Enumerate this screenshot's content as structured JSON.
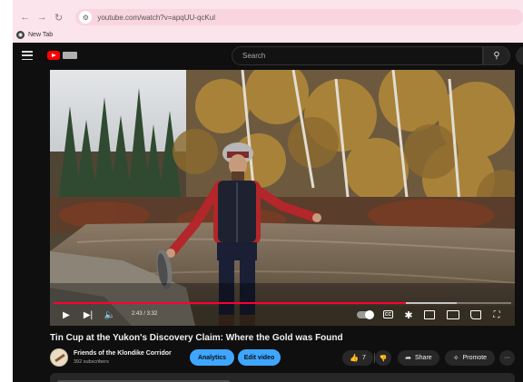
{
  "browser": {
    "back_icon": "arrow-left-icon",
    "forward_icon": "arrow-right-icon",
    "reload_icon": "reload-icon",
    "url": "youtube.com/watch?v=apqUU-qcKul",
    "bookmark_label": "New Tab"
  },
  "youtube": {
    "search_placeholder": "Search",
    "player": {
      "time": "2:43 / 3:32",
      "progress_fraction": 0.77,
      "buffer_fraction": 0.88
    },
    "video": {
      "title": "Tin Cup at the Yukon's Discovery Claim: Where the Gold was Found",
      "channel_name": "Friends of the Klondike Corridor",
      "subscribers": "392 subscribers",
      "analytics_label": "Analytics",
      "edit_label": "Edit video",
      "like_count": "7",
      "share_label": "Share",
      "promote_label": "Promote",
      "more_label": "···"
    }
  },
  "colors": {
    "browser_chrome": "#fce4ec",
    "app_background": "#0f0f0f",
    "accent_red": "#ff0033",
    "button_blue": "#3ea6ff"
  }
}
